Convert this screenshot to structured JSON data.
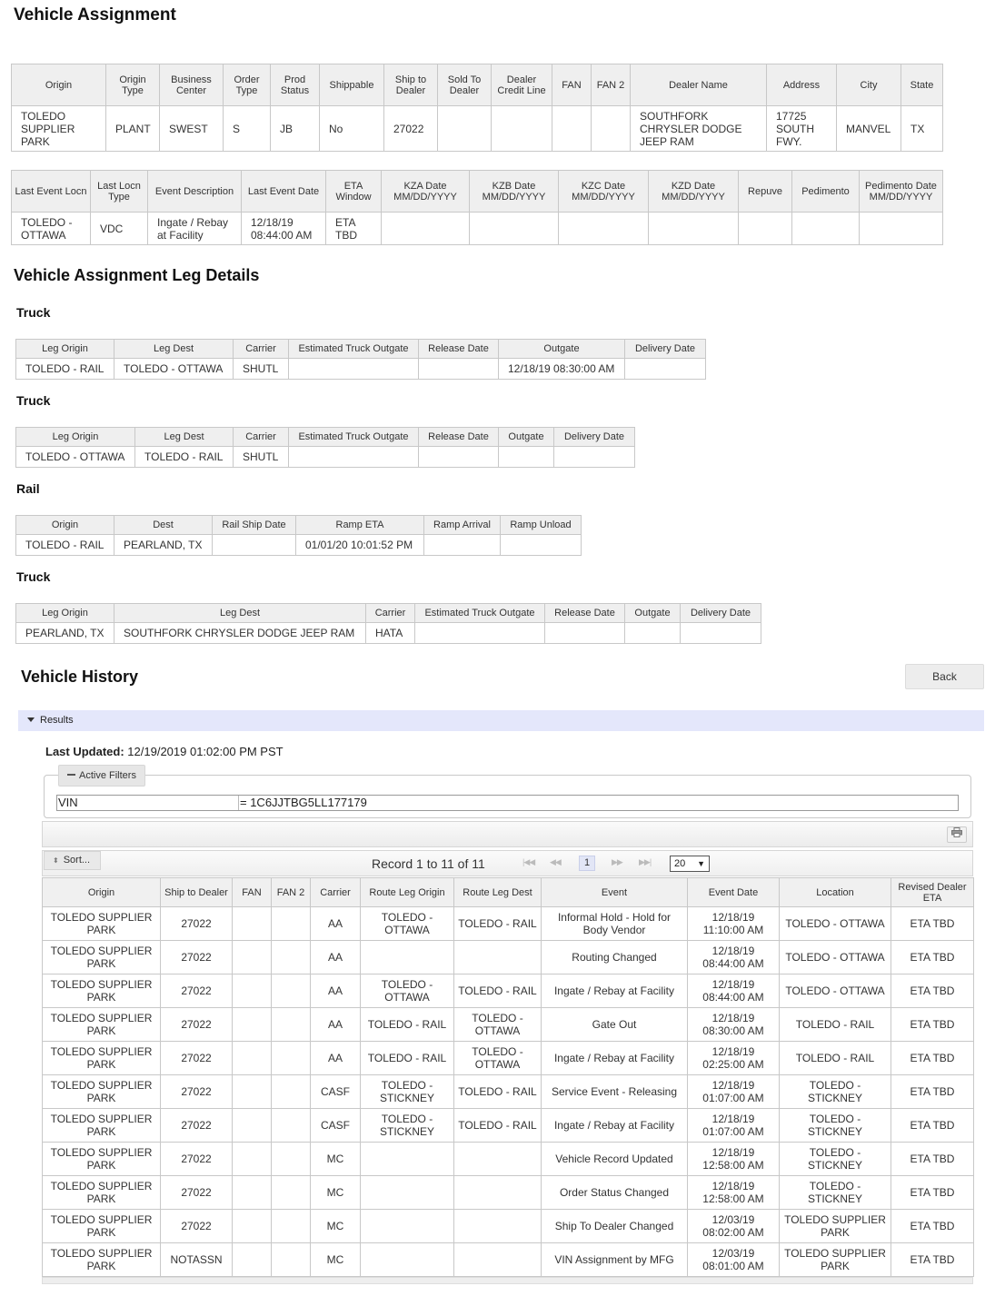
{
  "page_title": "Vehicle Assignment",
  "assignment": {
    "headers": [
      "Origin",
      "Origin Type",
      "Business Center",
      "Order Type",
      "Prod Status",
      "Shippable",
      "Ship to Dealer",
      "Sold To Dealer",
      "Dealer Credit Line",
      "FAN",
      "FAN 2",
      "Dealer Name",
      "Address",
      "City",
      "State"
    ],
    "row": [
      "TOLEDO SUPPLIER PARK",
      "PLANT",
      "SWEST",
      "S",
      "JB",
      "No",
      "27022",
      "",
      "",
      "",
      "",
      "SOUTHFORK CHRYSLER DODGE JEEP RAM",
      "17725 SOUTH FWY.",
      "MANVEL",
      "TX"
    ]
  },
  "event_summary": {
    "headers": [
      "Last Event Locn",
      "Last Locn Type",
      "Event Description",
      "Last Event Date",
      "ETA Window",
      "KZA Date MM/DD/YYYY",
      "KZB Date MM/DD/YYYY",
      "KZC Date MM/DD/YYYY",
      "KZD Date MM/DD/YYYY",
      "Repuve",
      "Pedimento",
      "Pedimento Date MM/DD/YYYY"
    ],
    "row": [
      "TOLEDO - OTTAWA",
      "VDC",
      "Ingate / Rebay at Facility",
      "12/18/19 08:44:00 AM",
      "ETA TBD",
      "",
      "",
      "",
      "",
      "",
      "",
      ""
    ]
  },
  "leg_details_title": "Vehicle Assignment Leg Details",
  "legs": [
    {
      "type": "Truck",
      "headers": [
        "Leg Origin",
        "Leg Dest",
        "Carrier",
        "Estimated Truck Outgate",
        "Release Date",
        "Outgate",
        "Delivery Date"
      ],
      "row": [
        "TOLEDO - RAIL",
        "TOLEDO - OTTAWA",
        "SHUTL",
        "",
        "",
        "12/18/19 08:30:00 AM",
        ""
      ]
    },
    {
      "type": "Truck",
      "headers": [
        "Leg Origin",
        "Leg Dest",
        "Carrier",
        "Estimated Truck Outgate",
        "Release Date",
        "Outgate",
        "Delivery Date"
      ],
      "row": [
        "TOLEDO - OTTAWA",
        "TOLEDO - RAIL",
        "SHUTL",
        "",
        "",
        "",
        ""
      ]
    },
    {
      "type": "Rail",
      "headers": [
        "Origin",
        "Dest",
        "Rail Ship Date",
        "Ramp ETA",
        "Ramp Arrival",
        "Ramp Unload"
      ],
      "row": [
        "TOLEDO - RAIL",
        "PEARLAND, TX",
        "",
        "01/01/20 10:01:52 PM",
        "",
        ""
      ]
    },
    {
      "type": "Truck",
      "headers": [
        "Leg Origin",
        "Leg Dest",
        "Carrier",
        "Estimated Truck Outgate",
        "Release Date",
        "Outgate",
        "Delivery Date"
      ],
      "row": [
        "PEARLAND, TX",
        "SOUTHFORK CHRYSLER DODGE JEEP RAM",
        "HATA",
        "",
        "",
        "",
        ""
      ]
    }
  ],
  "history": {
    "title": "Vehicle History",
    "back_label": "Back",
    "results_label": "Results",
    "last_updated_label": "Last Updated:",
    "last_updated_value": "12/19/2019 01:02:00 PM PST",
    "active_filters_label": "Active Filters",
    "filter_field": "VIN",
    "filter_value": "= 1C6JJTBG5LL177179",
    "sort_label": "Sort...",
    "record_text": "Record 1 to 11 of 11",
    "current_page": "1",
    "page_size": "20",
    "headers": [
      "Origin",
      "Ship to Dealer",
      "FAN",
      "FAN 2",
      "Carrier",
      "Route Leg Origin",
      "Route Leg Dest",
      "Event",
      "Event Date",
      "Location",
      "Revised Dealer ETA"
    ],
    "rows": [
      [
        "TOLEDO SUPPLIER PARK",
        "27022",
        "",
        "",
        "AA",
        "TOLEDO - OTTAWA",
        "TOLEDO - RAIL",
        "Informal Hold - Hold for Body Vendor",
        "12/18/19 11:10:00 AM",
        "TOLEDO - OTTAWA",
        "ETA TBD"
      ],
      [
        "TOLEDO SUPPLIER PARK",
        "27022",
        "",
        "",
        "AA",
        "",
        "",
        "Routing Changed",
        "12/18/19 08:44:00 AM",
        "TOLEDO - OTTAWA",
        "ETA TBD"
      ],
      [
        "TOLEDO SUPPLIER PARK",
        "27022",
        "",
        "",
        "AA",
        "TOLEDO - OTTAWA",
        "TOLEDO - RAIL",
        "Ingate / Rebay at Facility",
        "12/18/19 08:44:00 AM",
        "TOLEDO - OTTAWA",
        "ETA TBD"
      ],
      [
        "TOLEDO SUPPLIER PARK",
        "27022",
        "",
        "",
        "AA",
        "TOLEDO - RAIL",
        "TOLEDO - OTTAWA",
        "Gate Out",
        "12/18/19 08:30:00 AM",
        "TOLEDO - RAIL",
        "ETA TBD"
      ],
      [
        "TOLEDO SUPPLIER PARK",
        "27022",
        "",
        "",
        "AA",
        "TOLEDO - RAIL",
        "TOLEDO - OTTAWA",
        "Ingate / Rebay at Facility",
        "12/18/19 02:25:00 AM",
        "TOLEDO - RAIL",
        "ETA TBD"
      ],
      [
        "TOLEDO SUPPLIER PARK",
        "27022",
        "",
        "",
        "CASF",
        "TOLEDO - STICKNEY",
        "TOLEDO - RAIL",
        "Service Event - Releasing",
        "12/18/19 01:07:00 AM",
        "TOLEDO - STICKNEY",
        "ETA TBD"
      ],
      [
        "TOLEDO SUPPLIER PARK",
        "27022",
        "",
        "",
        "CASF",
        "TOLEDO - STICKNEY",
        "TOLEDO - RAIL",
        "Ingate / Rebay at Facility",
        "12/18/19 01:07:00 AM",
        "TOLEDO - STICKNEY",
        "ETA TBD"
      ],
      [
        "TOLEDO SUPPLIER PARK",
        "27022",
        "",
        "",
        "MC",
        "",
        "",
        "Vehicle Record Updated",
        "12/18/19 12:58:00 AM",
        "TOLEDO - STICKNEY",
        "ETA TBD"
      ],
      [
        "TOLEDO SUPPLIER PARK",
        "27022",
        "",
        "",
        "MC",
        "",
        "",
        "Order Status Changed",
        "12/18/19 12:58:00 AM",
        "TOLEDO - STICKNEY",
        "ETA TBD"
      ],
      [
        "TOLEDO SUPPLIER PARK",
        "27022",
        "",
        "",
        "MC",
        "",
        "",
        "Ship To Dealer Changed",
        "12/03/19 08:02:00 AM",
        "TOLEDO SUPPLIER PARK",
        "ETA TBD"
      ],
      [
        "TOLEDO SUPPLIER PARK",
        "NOTASSN",
        "",
        "",
        "MC",
        "",
        "",
        "VIN Assignment by MFG",
        "12/03/19 08:01:00 AM",
        "TOLEDO SUPPLIER PARK",
        "ETA TBD"
      ]
    ]
  }
}
